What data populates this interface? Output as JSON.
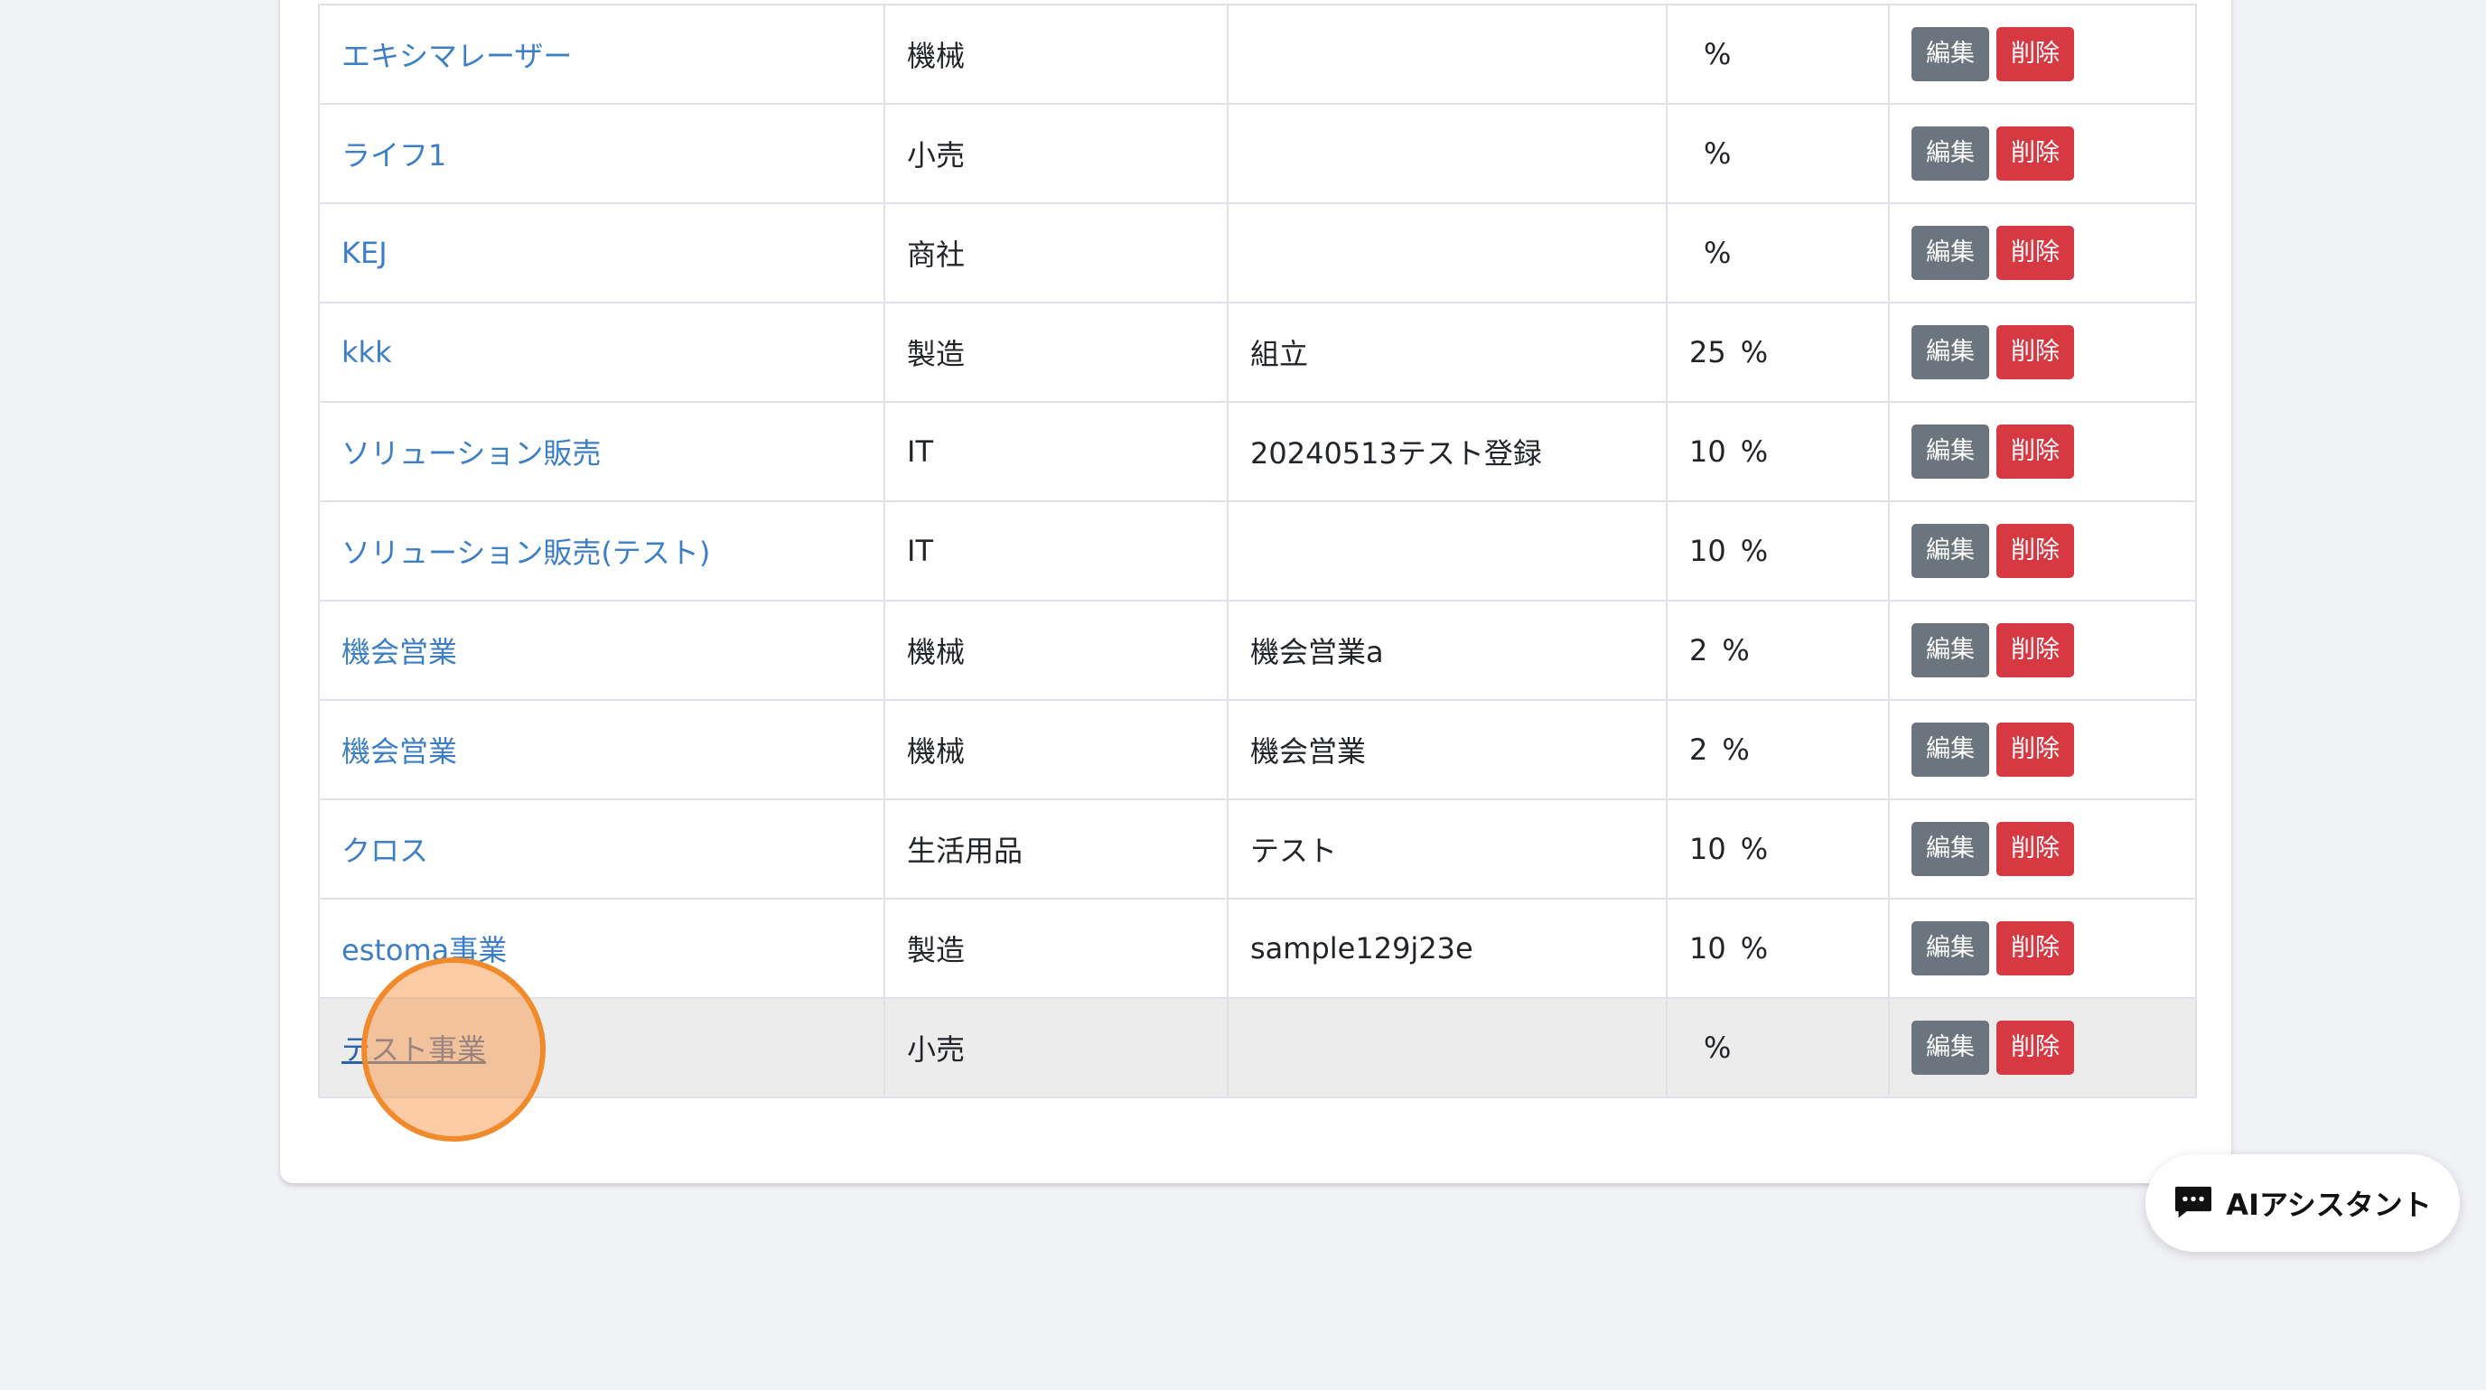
{
  "table": {
    "rows": [
      {
        "name": "エキシマレーザー",
        "industry": "機械",
        "note": "",
        "rate": "",
        "unit": "%"
      },
      {
        "name": "ライフ1",
        "industry": "小売",
        "note": "",
        "rate": "",
        "unit": "%"
      },
      {
        "name": "KEJ",
        "industry": "商社",
        "note": "",
        "rate": "",
        "unit": "%"
      },
      {
        "name": "kkk",
        "industry": "製造",
        "note": "組立",
        "rate": "25",
        "unit": "%"
      },
      {
        "name": "ソリューション販売",
        "industry": "IT",
        "note": "20240513テスト登録",
        "rate": "10",
        "unit": "%"
      },
      {
        "name": "ソリューション販売(テスト)",
        "industry": "IT",
        "note": "",
        "rate": "10",
        "unit": "%"
      },
      {
        "name": "機会営業",
        "industry": "機械",
        "note": "機会営業a",
        "rate": "2",
        "unit": "%"
      },
      {
        "name": "機会営業",
        "industry": "機械",
        "note": "機会営業",
        "rate": "2",
        "unit": "%"
      },
      {
        "name": "クロス",
        "industry": "生活用品",
        "note": "テスト",
        "rate": "10",
        "unit": "%"
      },
      {
        "name": "estoma事業",
        "industry": "製造",
        "note": "sample129j23e",
        "rate": "10",
        "unit": "%"
      },
      {
        "name": "テスト事業",
        "industry": "小売",
        "note": "",
        "rate": "",
        "unit": "%"
      }
    ],
    "edit_label": "編集",
    "delete_label": "削除"
  },
  "assistant": {
    "label": "AIアシスタント",
    "icon": "chat-icon"
  },
  "colors": {
    "link": "#3d7fc7",
    "edit_button": "#6c757d",
    "delete_button": "#d63942",
    "background": "#f1f2f6",
    "cursor_highlight": "#f18a2b"
  }
}
